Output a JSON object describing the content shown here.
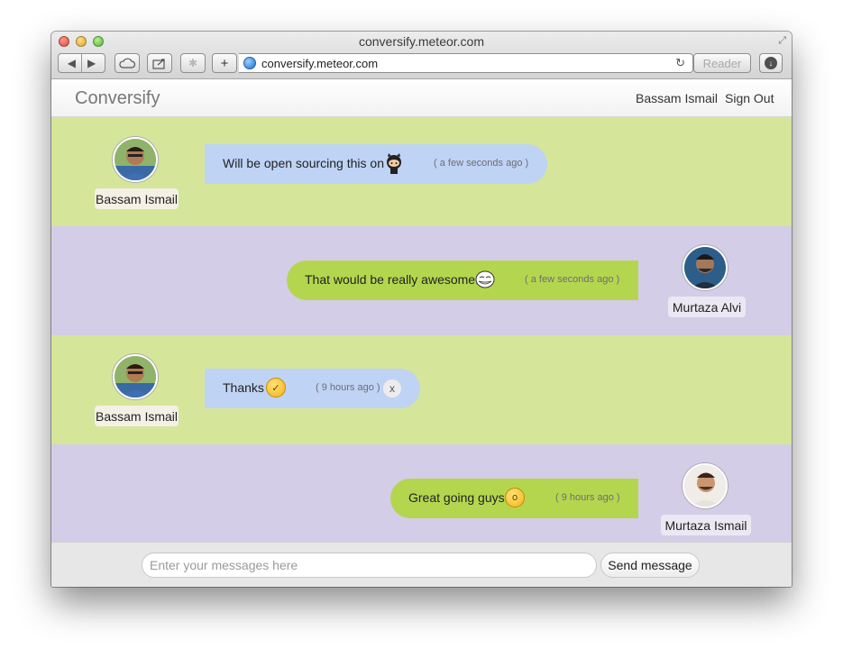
{
  "window": {
    "title": "conversify.meteor.com"
  },
  "toolbar": {
    "back_icon": "back-arrow-icon",
    "forward_icon": "forward-arrow-icon",
    "cloud_icon": "icloud-tabs-icon",
    "share_icon": "share-icon",
    "extension_icon": "extension-icon",
    "add_label": "+",
    "url": "conversify.meteor.com",
    "reader_label": "Reader",
    "reload_icon": "reload-icon",
    "download_icon": "download-icon"
  },
  "app": {
    "brand": "Conversify",
    "current_user": "Bassam Ismail",
    "sign_out_label": "Sign Out"
  },
  "messages": [
    {
      "side": "left",
      "author": "Bassam Ismail",
      "text": "Will be open sourcing this on",
      "emoji": "github-octocat-icon",
      "time": "( a few seconds ago )",
      "row_color": "#d5e69a"
    },
    {
      "side": "right",
      "author": "Murtaza Alvi",
      "text": "That would be really awesome.",
      "emoji": "trollface-icon",
      "time": "( a few seconds ago )",
      "row_color": "#d4cde8"
    },
    {
      "side": "left",
      "author": "Bassam Ismail",
      "text": "Thanks",
      "emoji": "laughing-emoji-icon",
      "time": "( 9 hours ago )",
      "delete_label": "x",
      "row_color": "#d5e69a"
    },
    {
      "side": "right",
      "author": "Murtaza Ismail",
      "text": "Great going guys.",
      "emoji": "surprised-emoji-icon",
      "time": "( 9 hours ago )",
      "row_color": "#d4cde8"
    }
  ],
  "composer": {
    "placeholder": "Enter your messages here",
    "value": "",
    "send_label": "Send message"
  },
  "colors": {
    "left_bubble": "#bfd3f5",
    "right_bubble": "#b4d64f"
  }
}
